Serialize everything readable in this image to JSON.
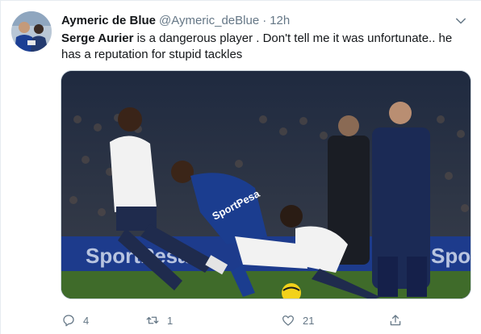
{
  "tweet": {
    "display_name": "Aymeric de Blue",
    "handle": "@Aymeric_deBlue",
    "separator": "·",
    "time": "12h",
    "text_bold": "Serge Aurier",
    "text_rest": " is a dangerous player . Don't tell me it was unfortunate.. he has a reputation for stupid tackles",
    "media": {
      "shirt_sponsor": "SportPesa",
      "board_left": "SportPesa",
      "board_right": "Spo"
    }
  },
  "actions": {
    "reply_count": "4",
    "retweet_count": "1",
    "like_count": "21"
  },
  "colors": {
    "text": "#14171a",
    "secondary": "#657786",
    "border": "#e6ecf0",
    "everton_blue": "#1b3d8f",
    "spurs_white": "#f2f2f2",
    "pitch": "#3f6b2a"
  },
  "icons": [
    "chevron-down-icon",
    "reply-icon",
    "retweet-icon",
    "like-icon",
    "share-icon"
  ]
}
